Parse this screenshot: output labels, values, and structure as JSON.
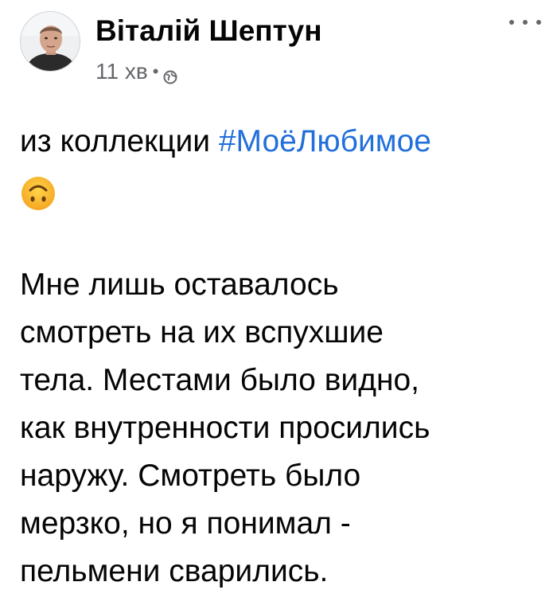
{
  "post": {
    "author_name": "Віталій Шептун",
    "timestamp": "11 хв",
    "separator": "•",
    "privacy_icon": "globe-icon",
    "more_icon": "more-dots-icon",
    "text_intro": "из коллекции ",
    "hashtag": "#МоёЛюбимое",
    "emoji_icon": "upside-down-face-icon",
    "body_lines": [
      "Мне лишь оставалось",
      "смотреть на их вспухшие",
      "тела. Местами было видно,",
      "как внутренности просились",
      "наружу. Смотреть было",
      "мерзко, но я понимал -",
      "пельмени сварились."
    ]
  },
  "colors": {
    "hashtag": "#216fdb",
    "meta_text": "#65676b",
    "main_text": "#050505"
  }
}
